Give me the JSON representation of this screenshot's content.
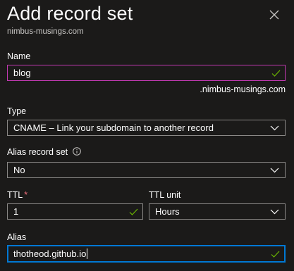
{
  "header": {
    "title": "Add record set",
    "subtitle": "nimbus-musings.com"
  },
  "form": {
    "name": {
      "label": "Name",
      "value": "blog",
      "suffix": ".nimbus-musings.com"
    },
    "type": {
      "label": "Type",
      "value": "CNAME – Link your subdomain to another record"
    },
    "alias_record_set": {
      "label": "Alias record set",
      "value": "No"
    },
    "ttl": {
      "label": "TTL",
      "required_marker": "*",
      "value": "1"
    },
    "ttl_unit": {
      "label": "TTL unit",
      "value": "Hours"
    },
    "alias": {
      "label": "Alias",
      "value": "thotheod.github.io"
    }
  },
  "icons": {
    "close": "close-icon",
    "check": "checkmark-icon",
    "dropdown": "chevron-down-icon",
    "info": "info-icon"
  },
  "colors": {
    "background": "#1b1a19",
    "border": "#8a8886",
    "validation_border": "#c239b3",
    "focus_border": "#0078d4",
    "check": "#6bb700",
    "required": "#f1707b"
  }
}
